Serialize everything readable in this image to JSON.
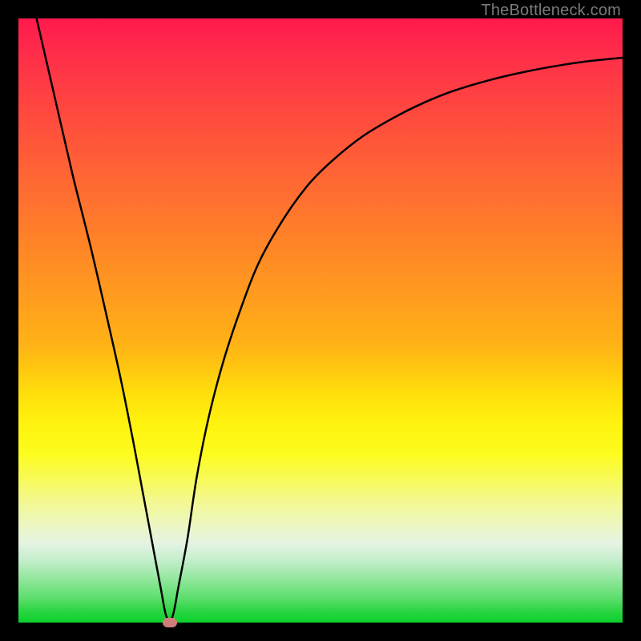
{
  "watermark": "TheBottleneck.com",
  "colors": {
    "frame": "#000000",
    "gradient_top": "#ff1a4d",
    "gradient_bottom": "#0ad02c",
    "curve": "#000000",
    "marker": "#cf7d78",
    "watermark_text": "#7a7a7a"
  },
  "chart_data": {
    "type": "line",
    "title": "",
    "xlabel": "",
    "ylabel": "",
    "xlim": [
      0,
      100
    ],
    "ylim": [
      0,
      100
    ],
    "x": [
      3,
      6,
      9,
      12,
      15,
      17,
      19,
      20.5,
      22,
      23.5,
      24.5,
      25.5,
      26.5,
      28,
      29.5,
      31.5,
      34,
      37,
      40,
      44,
      48,
      52,
      57,
      62,
      67,
      72,
      78,
      84,
      90,
      95,
      100
    ],
    "values": [
      100,
      87,
      74,
      62,
      49,
      40,
      30,
      22,
      14,
      6,
      1,
      1,
      6,
      14,
      24,
      34,
      43.5,
      52.5,
      60,
      67,
      72.5,
      76.5,
      80.5,
      83.5,
      86,
      88,
      89.8,
      91.2,
      92.3,
      93,
      93.5
    ],
    "marker": {
      "x": 25,
      "y": 0
    },
    "grid": false
  }
}
